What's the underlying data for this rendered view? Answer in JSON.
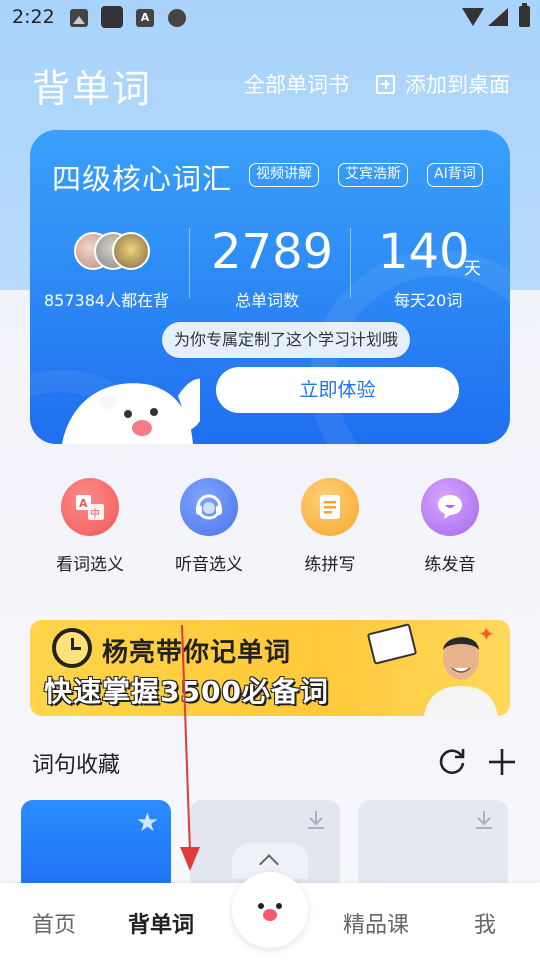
{
  "status_bar": {
    "time": "2:22"
  },
  "header": {
    "title": "背单词",
    "all_books": "全部单词书",
    "add_to_desktop": "添加到桌面"
  },
  "card": {
    "book_title": "四级核心词汇",
    "tags": [
      "视频讲解",
      "艾宾浩斯",
      "AI背词"
    ],
    "learners_text": "857384人都在背",
    "total_words": "2789",
    "total_words_label": "总单词数",
    "daily_number": "140",
    "daily_unit": "天",
    "daily_label": "每天20词",
    "tip": "为你专属定制了这个学习计划哦",
    "try_button": "立即体验"
  },
  "functions": [
    {
      "label": "看词选义",
      "icon": "translate-icon",
      "color": "#ef5e5c"
    },
    {
      "label": "听音选义",
      "icon": "headset-icon",
      "color": "#5179ec"
    },
    {
      "label": "练拼写",
      "icon": "notepad-icon",
      "color": "#f7aa30"
    },
    {
      "label": "练发音",
      "icon": "speech-bubble-icon",
      "color": "#a76cec"
    }
  ],
  "banner": {
    "line1": "杨亮带你记单词",
    "line2": "快速掌握3500必备词"
  },
  "collection": {
    "title": "词句收藏"
  },
  "bottom_nav": {
    "home": "首页",
    "words": "背单词",
    "course": "精品课",
    "me": "我"
  },
  "colors": {
    "accent": "#1f74ef",
    "header_bg": "#a9d3fb"
  }
}
